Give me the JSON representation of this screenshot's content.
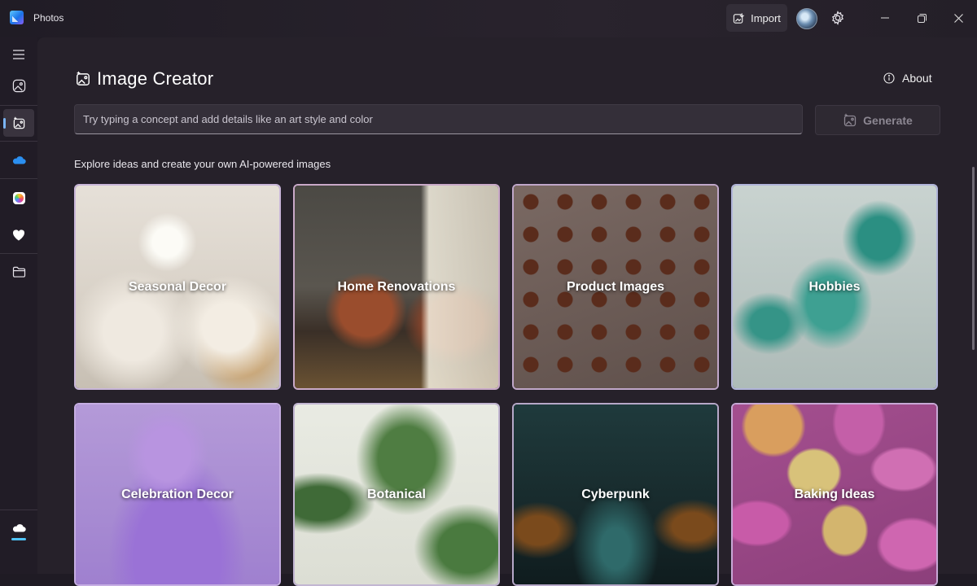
{
  "titlebar": {
    "app_title": "Photos",
    "import_label": "Import",
    "icons": [
      "photos-logo-icon",
      "import-icon",
      "avatar",
      "gear-icon",
      "minimize-icon",
      "restore-icon",
      "close-icon"
    ]
  },
  "sidebar": {
    "items": [
      {
        "name": "menu",
        "icon": "hamburger-icon"
      },
      {
        "name": "gallery",
        "icon": "photo-icon"
      },
      {
        "name": "image-creator",
        "icon": "image-creator-icon",
        "active": true
      },
      {
        "name": "onedrive",
        "icon": "cloud-icon"
      },
      {
        "name": "icloud",
        "icon": "icloud-photos-icon"
      },
      {
        "name": "favorites",
        "icon": "heart-icon"
      },
      {
        "name": "folders",
        "icon": "folder-icon"
      },
      {
        "name": "cloud-sync",
        "icon": "cloud-sync-icon"
      }
    ]
  },
  "main": {
    "title": "Image Creator",
    "about_label": "About",
    "prompt_placeholder": "Try typing a concept and add details like an art style and color",
    "generate_label": "Generate",
    "explore_text": "Explore ideas and create your own AI-powered images",
    "cards": [
      {
        "label": "Seasonal Decor"
      },
      {
        "label": "Home Renovations"
      },
      {
        "label": "Product Images"
      },
      {
        "label": "Hobbies"
      },
      {
        "label": "Celebration Decor"
      },
      {
        "label": "Botanical"
      },
      {
        "label": "Cyberpunk"
      },
      {
        "label": "Baking Ideas"
      }
    ]
  },
  "colors": {
    "background": "#1f1b24",
    "surface": "#26212a",
    "accent": "#7ab4f5",
    "card_border": "#b7a8d6"
  }
}
